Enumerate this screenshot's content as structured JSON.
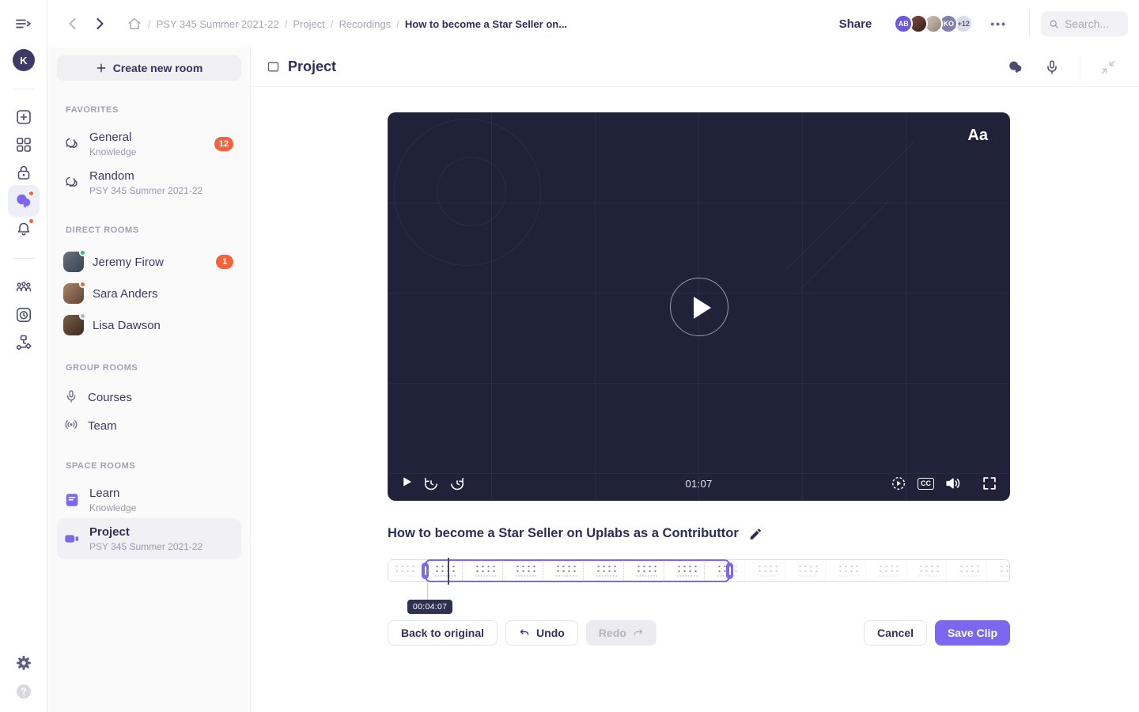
{
  "topbar": {
    "breadcrumb": {
      "sep": "/",
      "items": [
        "PSY 345 Summer 2021-22",
        "Project",
        "Recordings",
        "How to become a Star Seller on..."
      ]
    },
    "share": "Share",
    "avatars": {
      "first": "AB",
      "fourth": "KO",
      "more": "+12"
    },
    "search_placeholder": "Search..."
  },
  "rail": {
    "user_initial": "K"
  },
  "sidebar": {
    "create_room": "Create new room",
    "favorites_title": "FAVORITES",
    "general": {
      "name": "General",
      "subtitle": "Knowledge",
      "badge": "12"
    },
    "random": {
      "name": "Random",
      "subtitle": "PSY 345 Summer 2021-22"
    },
    "direct_title": "DIRECT ROOMS",
    "jeremy": {
      "name": "Jeremy Firow",
      "badge": "1"
    },
    "sara": {
      "name": "Sara Anders"
    },
    "lisa": {
      "name": "Lisa Dawson"
    },
    "group_title": "GROUP ROOMS",
    "courses": {
      "name": "Courses"
    },
    "team": {
      "name": "Team"
    },
    "space_title": "SPACE ROOMS",
    "learn": {
      "name": "Learn",
      "subtitle": "Knowledge"
    },
    "project": {
      "name": "Project",
      "subtitle": "PSY 345 Summer 2021-22"
    }
  },
  "main": {
    "header_title": "Project",
    "player": {
      "watermark": "Aa",
      "current_time": "01:07",
      "cc_label": "CC"
    },
    "clip_title": "How to become a Star Seller on Uplabs as a Contributtor",
    "tooltip_time": "00:04:07",
    "actions": {
      "back": "Back to original",
      "undo": "Undo",
      "redo": "Redo",
      "cancel": "Cancel",
      "save": "Save Clip"
    }
  },
  "colors": {
    "accent": "#7b68ee",
    "badge_orange": "#f4623d",
    "player_bg": "#20223a",
    "text_dark": "#32325d"
  }
}
